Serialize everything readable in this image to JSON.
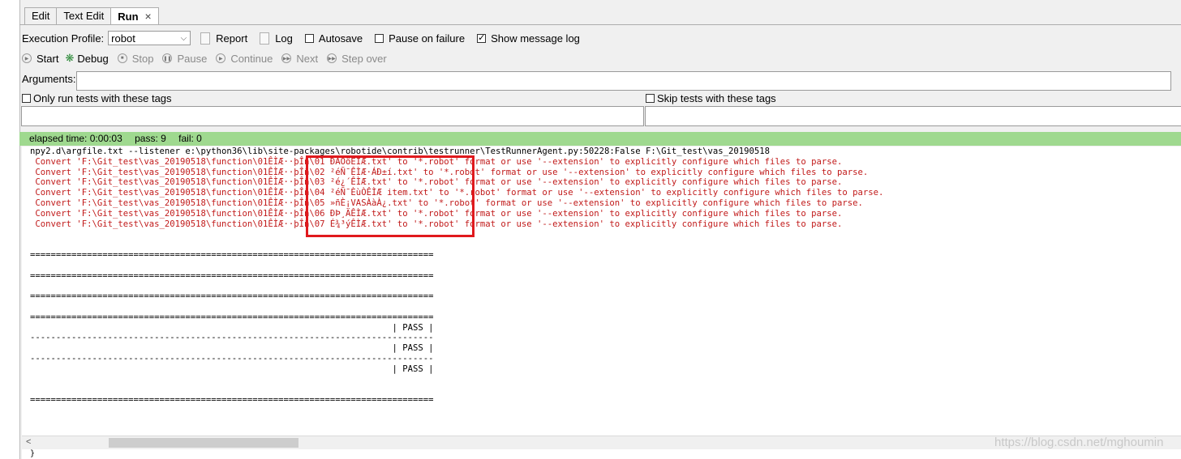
{
  "tabs": [
    {
      "label": "Edit"
    },
    {
      "label": "Text Edit"
    },
    {
      "label": "Run",
      "close": "×"
    }
  ],
  "profile": {
    "label": "Execution Profile:",
    "value": "robot",
    "report_label": "Report",
    "log_label": "Log",
    "autosave_label": "Autosave",
    "pause_label": "Pause on failure",
    "msglog_label": "Show message log",
    "autosave_checked": false,
    "pause_checked": false,
    "msglog_checked": true
  },
  "toolbar": {
    "start": "Start",
    "debug": "Debug",
    "stop": "Stop",
    "pause": "Pause",
    "continue": "Continue",
    "next": "Next",
    "step_over": "Step over"
  },
  "arguments": {
    "label": "Arguments:",
    "value": ""
  },
  "tags": {
    "only_run": "Only run tests with these tags",
    "skip": "Skip tests with these tags"
  },
  "status": {
    "elapsed": "elapsed time: 0:00:03",
    "pass": "pass: 9",
    "fail": "fail: 0"
  },
  "console": {
    "lines": [
      {
        "text": "npy2.d\\argfile.txt --listener e:\\python36\\lib\\site-packages\\robotide\\contrib\\testrunner\\TestRunnerAgent.py:50228:False F:\\Git_test\\vas_20190518",
        "color": "#000000"
      },
      {
        "text": " Convert 'F:\\Git_test\\vas_20190518\\function\\01ÊÌÆ··þÎñ\\01 ÐÂÔöÊÌÆ.txt' to '*.robot' format or use '--extension' to explicitly configure which files to parse.",
        "color": "#c11a1a"
      },
      {
        "text": " Convert 'F:\\Git_test\\vas_20190518\\function\\01ÊÌÆ··þÎñ\\02 ²éÑ¯ÊÌÆ·ÁÐ±í.txt' to '*.robot' format or use '--extension' to explicitly configure which files to parse.",
        "color": "#c11a1a"
      },
      {
        "text": " Convert 'F:\\Git_test\\vas_20190518\\function\\01ÊÌÆ··þÎñ\\03 ²é¿´ÊÌÆ.txt' to '*.robot' format or use '--extension' to explicitly configure which files to parse.",
        "color": "#c11a1a"
      },
      {
        "text": " Convert 'F:\\Git_test\\vas_20190518\\function\\01ÊÌÆ··þÎñ\\04 ²éÑ¯ÈùÒÊÌÆ item.txt' to '*.robot' format or use '--extension' to explicitly configure which files to parse.",
        "color": "#c11a1a"
      },
      {
        "text": " Convert 'F:\\Git_test\\vas_20190518\\function\\01ÊÌÆ··þÎñ\\05 »ñÈ¡VASÀàÀ¿.txt' to '*.robot' format or use '--extension' to explicitly configure which files to parse.",
        "color": "#c11a1a"
      },
      {
        "text": " Convert 'F:\\Git_test\\vas_20190518\\function\\01ÊÌÆ··þÎñ\\06 ÐÞ¸ÄÊÌÆ.txt' to '*.robot' format or use '--extension' to explicitly configure which files to parse.",
        "color": "#c11a1a"
      },
      {
        "text": " Convert 'F:\\Git_test\\vas_20190518\\function\\01ÊÌÆ··þÎñ\\07 É¾³ýÊÌÆ.txt' to '*.robot' format or use '--extension' to explicitly configure which files to parse.",
        "color": "#c11a1a"
      },
      {
        "text": "",
        "color": "#000000"
      },
      {
        "text": "",
        "color": "#000000"
      },
      {
        "text": "==============================================================================",
        "color": "#000000"
      },
      {
        "text": "",
        "color": "#000000"
      },
      {
        "text": "==============================================================================",
        "color": "#000000"
      },
      {
        "text": "",
        "color": "#000000"
      },
      {
        "text": "==============================================================================",
        "color": "#000000"
      },
      {
        "text": "",
        "color": "#000000"
      },
      {
        "text": "==============================================================================",
        "color": "#000000"
      },
      {
        "text": "                                                                      | PASS |",
        "color": "#000000"
      },
      {
        "text": "------------------------------------------------------------------------------",
        "color": "#000000"
      },
      {
        "text": "                                                                      | PASS |",
        "color": "#000000"
      },
      {
        "text": "------------------------------------------------------------------------------",
        "color": "#000000"
      },
      {
        "text": "                                                                      | PASS |",
        "color": "#000000"
      },
      {
        "text": "",
        "color": "#000000"
      },
      {
        "text": "",
        "color": "#000000"
      },
      {
        "text": "==============================================================================",
        "color": "#000000"
      }
    ]
  },
  "scroll": {
    "left_arrow": "<"
  },
  "bottom_text": "}",
  "watermark": "https://blog.csdn.net/mghoumin"
}
